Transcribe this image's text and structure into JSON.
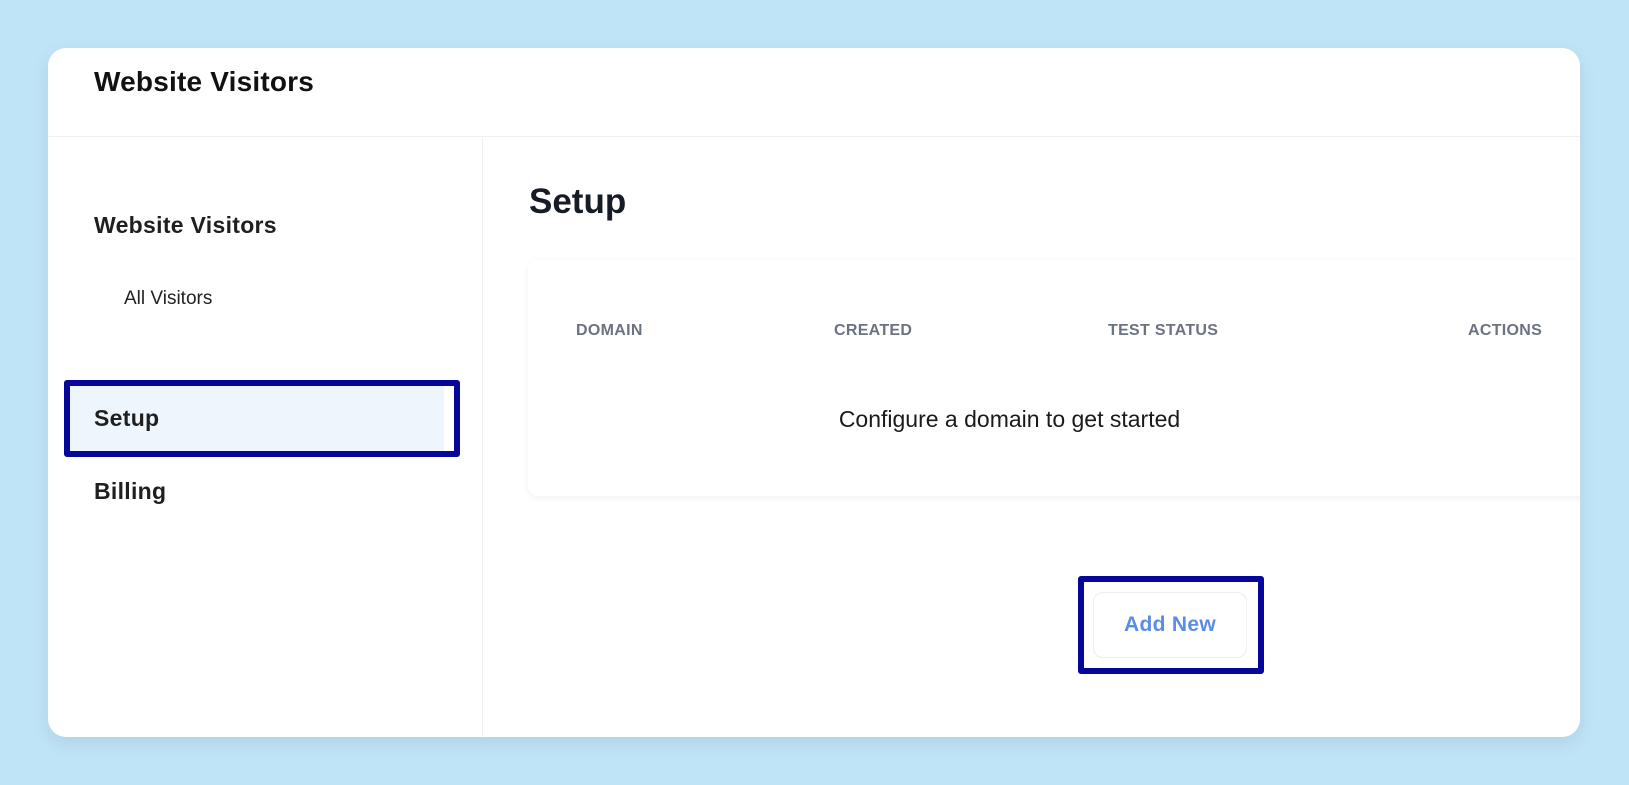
{
  "header": {
    "title": "Website Visitors"
  },
  "sidebar": {
    "section_title": "Website Visitors",
    "items": [
      {
        "label": "All Visitors",
        "active": false
      },
      {
        "label": "Setup",
        "active": true
      },
      {
        "label": "Billing",
        "active": false
      }
    ]
  },
  "main": {
    "page_title": "Setup",
    "table": {
      "columns": [
        "DOMAIN",
        "CREATED",
        "TEST STATUS",
        "ACTIONS"
      ],
      "rows": [],
      "empty_message": "Configure a domain to get started"
    },
    "add_button_label": "Add New"
  },
  "colors": {
    "background": "#bfe3f7",
    "highlight_border": "#06069a",
    "active_item_bg": "#edf6fd",
    "button_text": "#5a8de8",
    "header_text": "#6b7280"
  }
}
